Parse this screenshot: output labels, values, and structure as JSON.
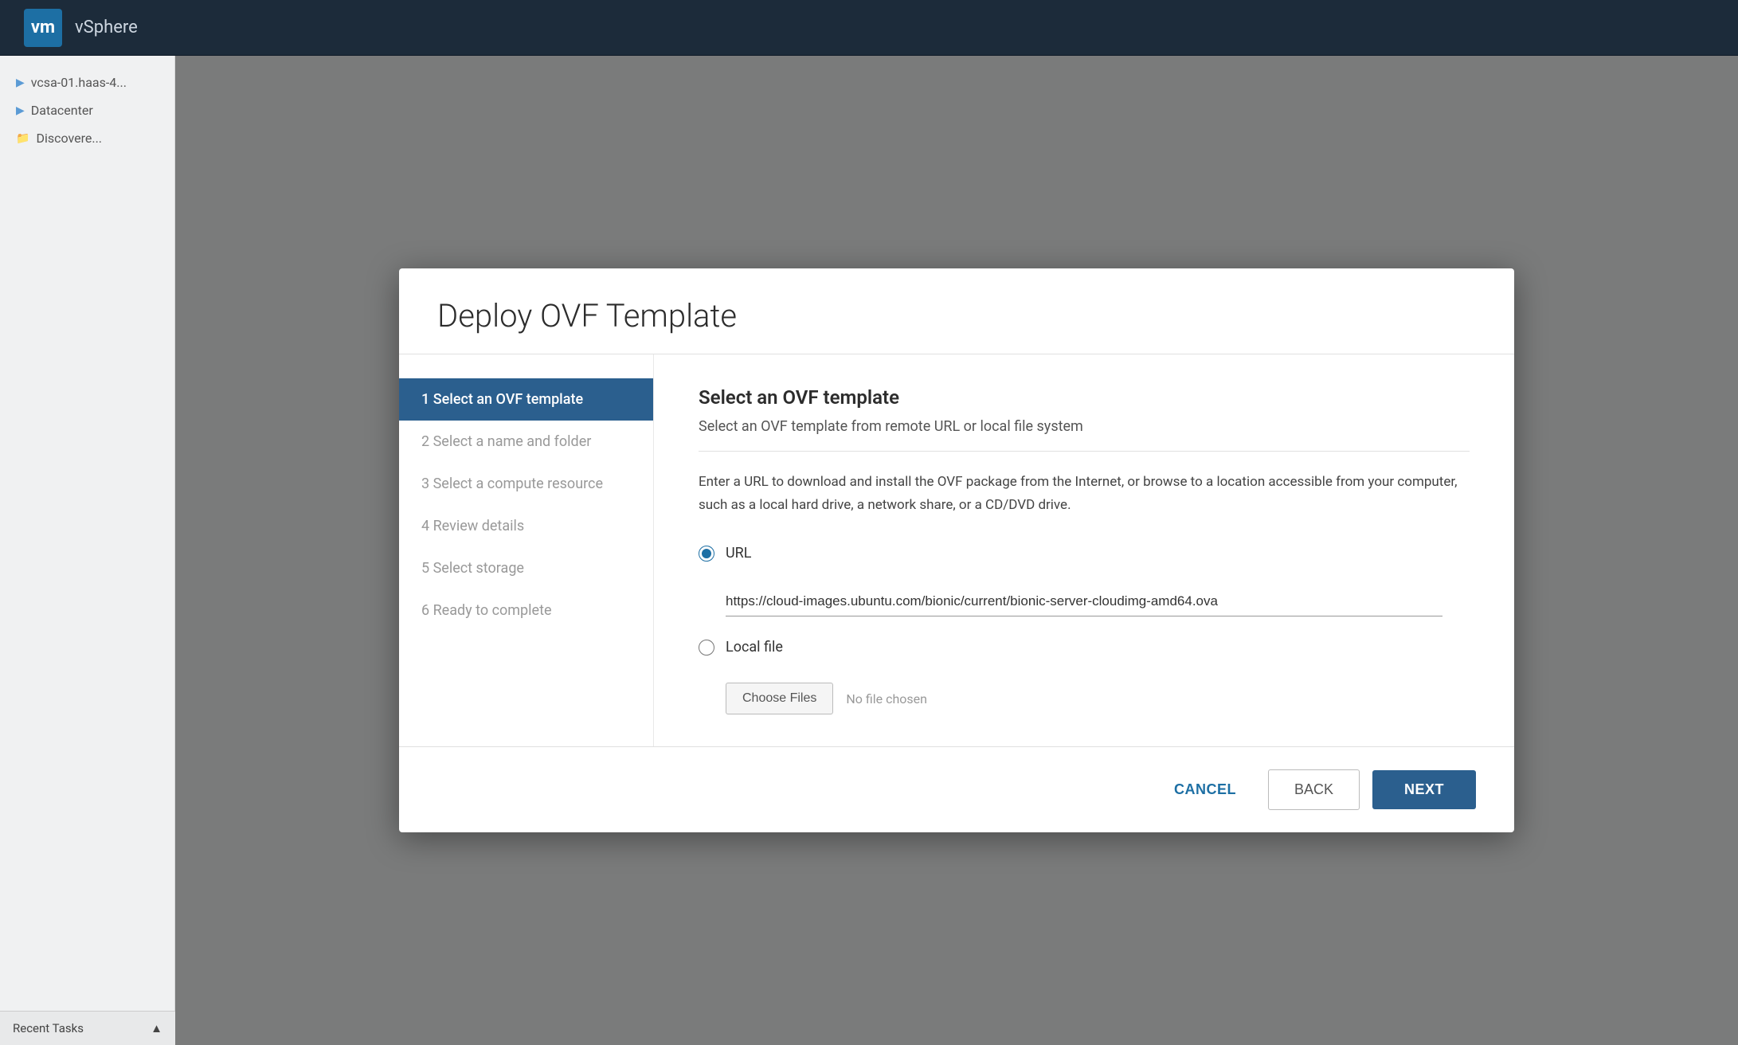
{
  "app": {
    "logo_text": "vm",
    "title": "vSphere"
  },
  "sidebar": {
    "items": [
      {
        "label": "vcsa-01.haas-4...",
        "icon": "server"
      },
      {
        "label": "Datacenter",
        "icon": "folder"
      },
      {
        "label": "Discovere...",
        "icon": "folder"
      }
    ]
  },
  "recent_tasks": {
    "label": "Recent Tasks"
  },
  "modal": {
    "title": "Deploy OVF Template",
    "steps": [
      {
        "number": "1",
        "label": "Select an OVF template",
        "active": true
      },
      {
        "number": "2",
        "label": "Select a name and folder",
        "active": false
      },
      {
        "number": "3",
        "label": "Select a compute resource",
        "active": false
      },
      {
        "number": "4",
        "label": "Review details",
        "active": false
      },
      {
        "number": "5",
        "label": "Select storage",
        "active": false
      },
      {
        "number": "6",
        "label": "Ready to complete",
        "active": false
      }
    ],
    "content": {
      "title": "Select an OVF template",
      "subtitle": "Select an OVF template from remote URL or local file system",
      "description": "Enter a URL to download and install the OVF package from the Internet, or browse to a location accessible from your computer, such as a local hard drive, a network share, or a CD/DVD drive.",
      "url_option": {
        "label": "URL",
        "value": "https://cloud-images.ubuntu.com/bionic/current/bionic-server-cloudimg-amd64.ova"
      },
      "local_file_option": {
        "label": "Local file",
        "choose_files_label": "Choose Files",
        "no_file_text": "No file chosen"
      }
    },
    "footer": {
      "cancel_label": "CANCEL",
      "back_label": "BACK",
      "next_label": "NEXT"
    }
  }
}
